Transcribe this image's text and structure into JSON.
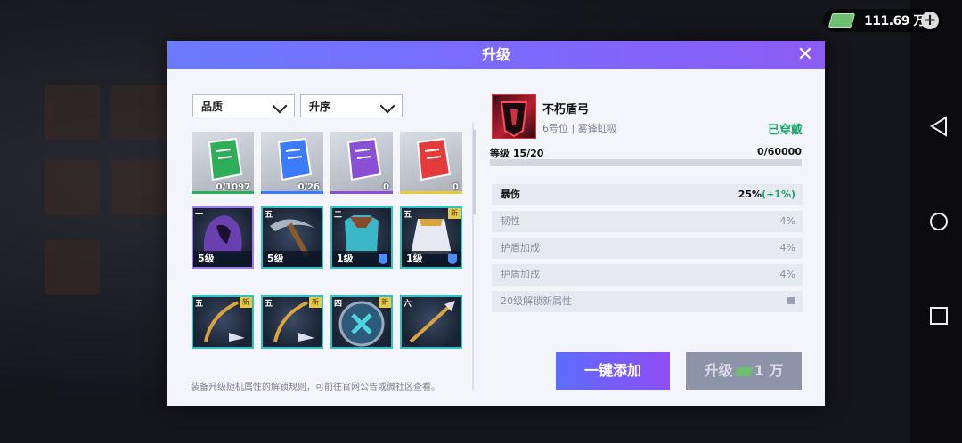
{
  "currency": {
    "amount": "111.69 万",
    "icon": "cash-icon"
  },
  "dialog": {
    "title": "升级"
  },
  "filters": {
    "quality": "品质",
    "order": "升序"
  },
  "materials": [
    {
      "count": "0/1097",
      "color": "#2fae5a"
    },
    {
      "count": "0/26",
      "color": "#3a7bff"
    },
    {
      "count": "0",
      "color": "#8b4fd6"
    },
    {
      "count": "0",
      "color": "#e53b3b"
    }
  ],
  "gear": [
    {
      "grade": "一",
      "level": "5级",
      "new": false,
      "shield": false
    },
    {
      "grade": "五",
      "level": "5级",
      "new": false,
      "shield": false
    },
    {
      "grade": "二",
      "level": "1级",
      "new": false,
      "shield": true
    },
    {
      "grade": "五",
      "level": "1级",
      "new": true,
      "shield": true
    },
    {
      "grade": "五",
      "level": "",
      "new": true,
      "shield": false
    },
    {
      "grade": "五",
      "level": "",
      "new": true,
      "shield": false
    },
    {
      "grade": "四",
      "level": "",
      "new": true,
      "shield": false
    },
    {
      "grade": "六",
      "level": "",
      "new": false,
      "shield": false
    }
  ],
  "new_tag": "新",
  "item": {
    "name": "不朽盾弓",
    "slot": "6号位 | 雾锋虹吸",
    "status": "已穿戴",
    "level_label": "等级 15/20",
    "exp": "0/60000",
    "exp_fraction": 0
  },
  "stats": [
    {
      "name": "暴伤",
      "value": "25%",
      "bonus": "(+1%)"
    },
    {
      "name": "韧性",
      "value": "4%"
    },
    {
      "name": "护盾加成",
      "value": "4%"
    },
    {
      "name": "护盾加成",
      "value": "4%"
    },
    {
      "name": "20级解锁新属性",
      "value": ""
    }
  ],
  "buttons": {
    "auto_add": "一键添加",
    "upgrade": "升级",
    "upgrade_cost": "1 万"
  },
  "note": "装备升级随机属性的解锁规则，可前往官网公告或微社区查看。"
}
